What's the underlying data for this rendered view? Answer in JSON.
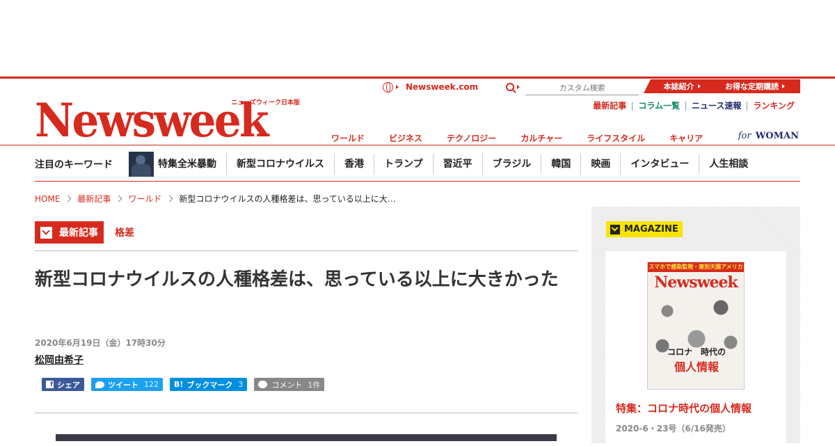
{
  "header": {
    "logo_sub": "ニューズウィーク日本版",
    "logo_main": "Newsweek",
    "site_link": "Newsweek.com",
    "search_placeholder": "カスタム検索",
    "pill_about": "本誌紹介",
    "pill_subscribe": "お得な定期購読",
    "subnav": [
      "最新記事",
      "コラム一覧",
      "ニュース速報",
      "ランキング"
    ],
    "subnav_colors": [
      "#d62a1e",
      "#1a8a6e",
      "#1f2d6e",
      "#d62a1e"
    ],
    "mainnav": [
      "ワールド",
      "ビジネス",
      "テクノロジー",
      "カルチャー",
      "ライフスタイル",
      "キャリア"
    ],
    "for_woman_for": "for",
    "for_woman_woman": "WOMAN"
  },
  "keywords": {
    "title": "注目のキーワード",
    "items": [
      "特集全米暴動",
      "新型コロナウイルス",
      "香港",
      "トランプ",
      "習近平",
      "ブラジル",
      "韓国",
      "映画",
      "インタビュー",
      "人生相談"
    ]
  },
  "breadcrumb": [
    "HOME",
    "最新記事",
    "ワールド",
    "新型コロナウイルスの人種格差は、思っている以上に大…"
  ],
  "article": {
    "category": "最新記事",
    "tag": "格差",
    "title": "新型コロナウイルスの人種格差は、思っている以上に大きかった",
    "date": "2020年6月19日（金）17時30分",
    "author": "松岡由希子"
  },
  "social": {
    "share": "シェア",
    "tweet": "ツイート",
    "tweet_count": "122",
    "bookmark": "ブックマーク",
    "bookmark_count": "3",
    "comment": "コメント",
    "comment_count": "1件"
  },
  "magazine": {
    "badge": "MAGAZINE",
    "cover_banner": "スマホで感染監視・差別天国アメリカ",
    "cover_logo": "Newsweek",
    "cover_line1": "コロナ　時代の",
    "cover_line2": "個人情報",
    "feature_title": "特集：コロナ時代の個人情報",
    "issue": "2020-6・23号（6/16発売）"
  },
  "colors": {
    "brand_red": "#d62a1e",
    "magazine_yellow": "#f7e400"
  }
}
